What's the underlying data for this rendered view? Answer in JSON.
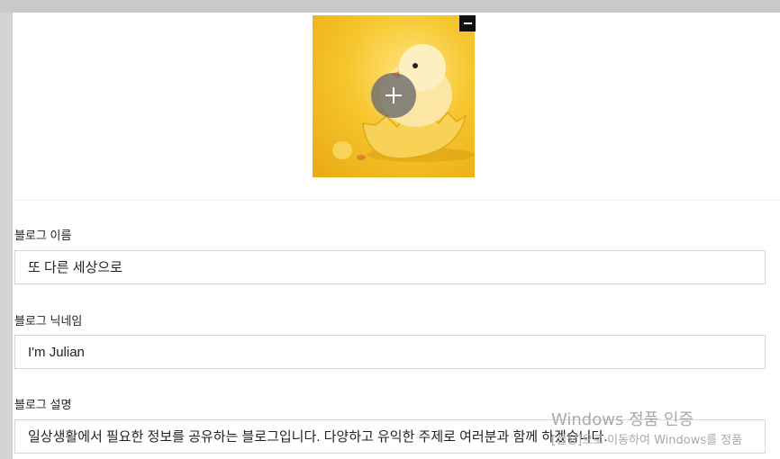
{
  "profile": {
    "image_alt": "chick-hatching-from-egg",
    "remove_icon": "minus-icon",
    "add_icon": "plus-icon"
  },
  "fields": {
    "name": {
      "label": "블로그 이름",
      "value": "또 다른 세상으로"
    },
    "nickname": {
      "label": "블로그 닉네임",
      "value": "I'm Julian"
    },
    "description": {
      "label": "블로그 설명",
      "value": "일상생활에서 필요한 정보를 공유하는 블로그입니다. 다양하고 유익한 주제로 여러분과 함께 하겠습니다."
    }
  },
  "watermark": {
    "line1": "Windows 정품 인증",
    "line2": "[설정]으로 이동하여 Windows를 정품"
  },
  "colors": {
    "accent_yellow": "#f2c32a",
    "border": "#d6d6d6"
  }
}
